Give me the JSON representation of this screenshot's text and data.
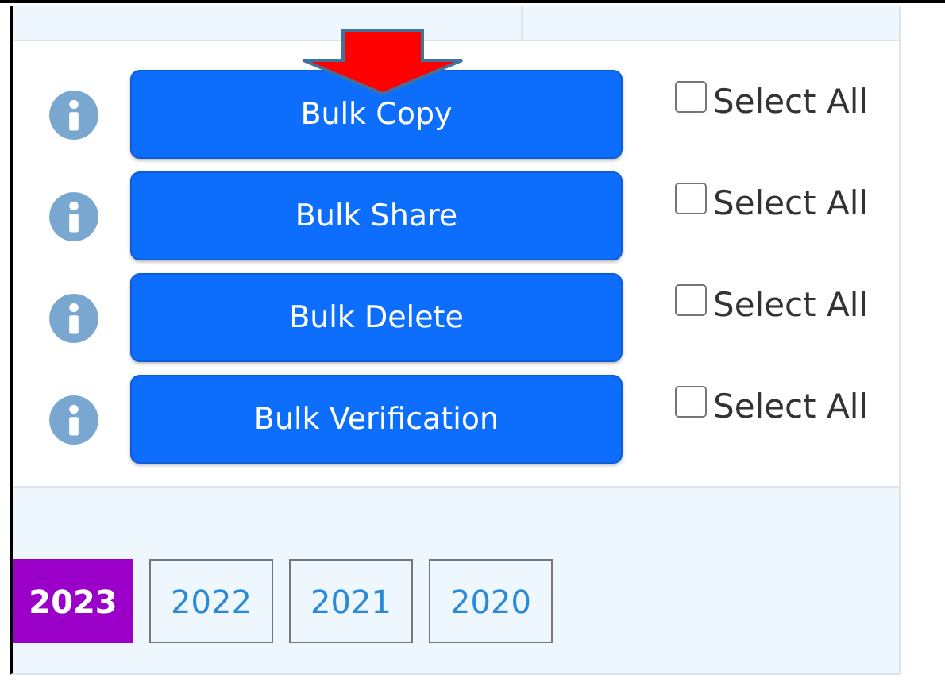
{
  "actions": [
    {
      "label": "Bulk Copy",
      "checkbox_label": "Select All",
      "checked": false
    },
    {
      "label": "Bulk Share",
      "checkbox_label": "Select All",
      "checked": false
    },
    {
      "label": "Bulk Delete",
      "checkbox_label": "Select All",
      "checked": false
    },
    {
      "label": "Bulk Verification",
      "checkbox_label": "Select All",
      "checked": false
    }
  ],
  "years": [
    {
      "label": "2023",
      "selected": true
    },
    {
      "label": "2022",
      "selected": false
    },
    {
      "label": "2021",
      "selected": false
    },
    {
      "label": "2020",
      "selected": false
    }
  ]
}
